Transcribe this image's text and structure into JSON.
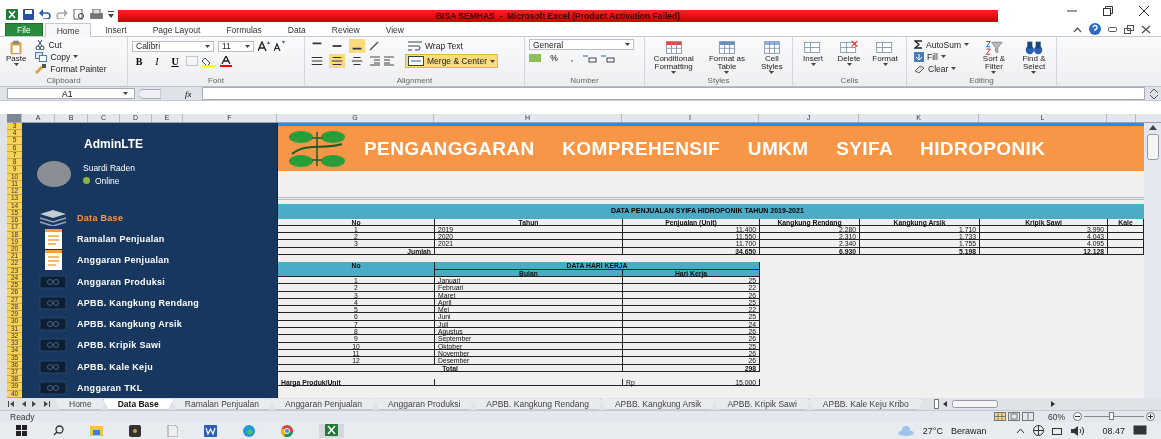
{
  "window": {
    "title": "BISA SEMHAS  -  Microsoft Excel (Product Activation Failed)"
  },
  "ribbon_tabs": [
    {
      "label": "File",
      "selected": false
    },
    {
      "label": "Home",
      "selected": true
    },
    {
      "label": "Insert",
      "selected": false
    },
    {
      "label": "Page Layout",
      "selected": false
    },
    {
      "label": "Formulas",
      "selected": false
    },
    {
      "label": "Data",
      "selected": false
    },
    {
      "label": "Review",
      "selected": false
    },
    {
      "label": "View",
      "selected": false
    }
  ],
  "ribbon_groups": [
    {
      "kind": "clipboard",
      "label": "Clipboard",
      "large": [
        "Paste"
      ],
      "small": [
        "Cut",
        "Copy",
        "Format Painter"
      ]
    },
    {
      "kind": "font",
      "label": "Font",
      "font_name": "Calibri",
      "font_size": "11",
      "styles": [
        "B",
        "I",
        "U"
      ]
    },
    {
      "kind": "alignment",
      "label": "Alignment",
      "vertical_align": [
        {
          "selected": false
        },
        {
          "selected": false
        },
        {
          "selected": true
        }
      ],
      "horizontal_align": [
        {
          "selected": false
        },
        {
          "selected": true
        },
        {
          "selected": false
        }
      ],
      "buttons": [
        {
          "label": "Wrap Text",
          "on": false
        },
        {
          "label": "Merge & Center",
          "on": true
        }
      ]
    },
    {
      "kind": "number",
      "label": "Number",
      "format": "General",
      "symbols": [
        "%",
        ","
      ]
    },
    {
      "kind": "styles",
      "label": "Styles",
      "large": [
        "Conditional Formatting",
        "Format as Table",
        "Cell Styles"
      ]
    },
    {
      "kind": "cells",
      "label": "Cells",
      "large": [
        "Insert",
        "Delete",
        "Format"
      ]
    },
    {
      "kind": "editing",
      "label": "Editing",
      "small": [
        "AutoSum",
        "Fill",
        "Clear"
      ],
      "large": [
        "Sort & Filter",
        "Find & Select"
      ]
    }
  ],
  "formula_bar": {
    "name_box": "A1",
    "function_label": "fx"
  },
  "column_headers": [
    "A",
    "B",
    "C",
    "D",
    "E",
    "F",
    "G",
    "H",
    "I",
    "J",
    "K",
    "L"
  ],
  "row_numbers": [
    "3",
    "4",
    "5",
    "6",
    "7",
    "8",
    "9",
    "10",
    "11",
    "12",
    "13",
    "14",
    "15",
    "16",
    "17",
    "18",
    "19",
    "20",
    "21",
    "22",
    "23",
    "24",
    "25",
    "26",
    "27",
    "28",
    "29",
    "30",
    "31",
    "32",
    "33",
    "34",
    "35",
    "36",
    "37",
    "38",
    "39",
    "40"
  ],
  "sidebar": {
    "brand": "AdminLTE",
    "user": "Suardi Raden",
    "status": "Online",
    "items": [
      {
        "label": "Data Base",
        "kind": "layers",
        "selected": true
      },
      {
        "label": "Ramalan Penjualan",
        "kind": "document",
        "selected": false
      },
      {
        "label": "Anggaran Penjualan",
        "kind": "document",
        "selected": false
      },
      {
        "label": "Anggaran Produksi",
        "kind": "card",
        "selected": false
      },
      {
        "label": "APBB. Kangkung Rendang",
        "kind": "card",
        "selected": false
      },
      {
        "label": "APBB. Kangkung Arsik",
        "kind": "card",
        "selected": false
      },
      {
        "label": "APBB. Kripik Sawi",
        "kind": "card",
        "selected": false
      },
      {
        "label": "APBB. Kale Keju",
        "kind": "card",
        "selected": false
      },
      {
        "label": "Anggaran TKL",
        "kind": "card",
        "selected": false
      }
    ]
  },
  "banner": {
    "title": "PENGANGGARAN KOMPREHENSIF UMKM SYIFA HIDROPONIK"
  },
  "sales_table": {
    "title": "DATA PENJUALAN SYIFA HIDROPONIK TAHUN 2019-2021",
    "columns": [
      "No",
      "Tahun",
      "Penjualan (Unit)",
      "Kangkung Rendang",
      "Kangkung Arsik",
      "Kripik Sawi",
      "Kale"
    ],
    "rows": [
      [
        "1",
        "2019",
        "11.400",
        "2.280",
        "1.710",
        "3.990"
      ],
      [
        "2",
        "2020",
        "11.550",
        "2.310",
        "1.733",
        "4.043"
      ],
      [
        "3",
        "2021",
        "11.700",
        "2.340",
        "1.755",
        "4.095"
      ]
    ],
    "total": {
      "label": "Jumlah",
      "values": [
        "34.650",
        "6.930",
        "5.198",
        "12.128"
      ]
    }
  },
  "workday_table": {
    "title": "DATA HARI KERJA",
    "columns": [
      "No",
      "Bulan",
      "Hari Kerja"
    ],
    "rows": [
      [
        "1",
        "Januari",
        "25"
      ],
      [
        "2",
        "Februari",
        "22"
      ],
      [
        "3",
        "Maret",
        "26"
      ],
      [
        "4",
        "April",
        "25"
      ],
      [
        "5",
        "Mei",
        "22"
      ],
      [
        "6",
        "Juni",
        "25"
      ],
      [
        "7",
        "Juli",
        "24"
      ],
      [
        "8",
        "Agustus",
        "26"
      ],
      [
        "9",
        "September",
        "26"
      ],
      [
        "10",
        "Oktober",
        "25"
      ],
      [
        "11",
        "November",
        "26"
      ],
      [
        "12",
        "Desember",
        "26"
      ]
    ],
    "total": {
      "label": "Total",
      "value": "298"
    }
  },
  "price": {
    "label": "Harga Produk/Unit",
    "currency": "Rp",
    "value": "15.000"
  },
  "sheet_tabs": [
    {
      "label": "Home",
      "selected": false
    },
    {
      "label": "Data Base",
      "selected": true
    },
    {
      "label": "Ramalan Penjualan",
      "selected": false
    },
    {
      "label": "Anggaran Penjualan",
      "selected": false
    },
    {
      "label": "Anggaran Produksi",
      "selected": false
    },
    {
      "label": "APBB. Kangkung Rendang",
      "selected": false
    },
    {
      "label": "APBB. Kangkung Arsik",
      "selected": false
    },
    {
      "label": "APBB. Kripik Sawi",
      "selected": false
    },
    {
      "label": "APBB. Kale Keju Kribo",
      "selected": false
    }
  ],
  "status_bar": {
    "status": "Ready",
    "zoom": "60%",
    "zoom_slider": {
      "level": 0.45
    }
  },
  "taskbar": {
    "temperature": "27°C",
    "weather": "Berawan",
    "time": "08.47"
  }
}
